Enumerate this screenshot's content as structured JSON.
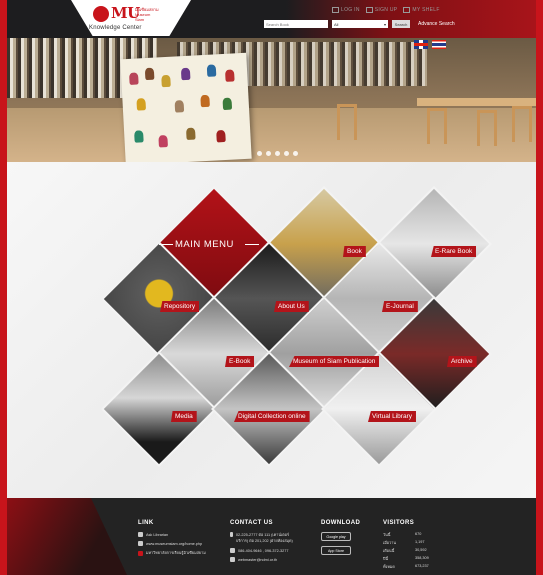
{
  "header": {
    "logo_text": "MU",
    "logo_subtitle": "มิวเซียมสยาม Museum Siam",
    "logo_caption": "Knowledge Center",
    "links": [
      {
        "label": "LOG IN",
        "icon": "login-icon"
      },
      {
        "label": "SIGN UP",
        "icon": "signup-icon"
      },
      {
        "label": "MY SHELF",
        "icon": "shelf-icon"
      }
    ],
    "search": {
      "placeholder": "Search Book",
      "scope": "All",
      "button": "Search",
      "advanced": "Advance Search"
    },
    "languages": [
      "English",
      "Thai"
    ]
  },
  "hero": {
    "slides": 5,
    "active_slide": 1
  },
  "menu": {
    "title": "MAIN MENU",
    "tiles": [
      {
        "label": "Book"
      },
      {
        "label": "E-Rare Book"
      },
      {
        "label": "Repository"
      },
      {
        "label": "About Us"
      },
      {
        "label": "E-Journal"
      },
      {
        "label": "E-Book"
      },
      {
        "label": "Museum of Siam Publication"
      },
      {
        "label": "Archive"
      },
      {
        "label": "Media"
      },
      {
        "label": "Digital Collection online"
      },
      {
        "label": "Virtual Library"
      }
    ]
  },
  "footer": {
    "link": {
      "heading": "LINK",
      "items": [
        {
          "label": "Ask Librarian",
          "icon": "chat-icon"
        },
        {
          "label": "www.museumsiam.org/home.php",
          "icon": "globe-icon"
        },
        {
          "label": "มหาวิทยาลัยการเรียนรู้มิวเซียมสยาม",
          "icon": "info-icon"
        }
      ]
    },
    "contact": {
      "heading": "CONTACT US",
      "items": [
        {
          "label": "02-225-2777 ต่อ 111 (เคาน์เตอร์บริการ) ต่อ 201,202 (ฝ่ายห้องสมุด)",
          "icon": "phone-icon"
        },
        {
          "label": "086-404-9646 , 096-372-3277",
          "icon": "mobile-icon"
        },
        {
          "label": "webmaster@ndmi.or.th",
          "icon": "mail-icon"
        }
      ]
    },
    "download": {
      "heading": "DOWNLOAD",
      "badges": [
        "Google play",
        "App Store"
      ]
    },
    "visitors": {
      "heading": "VISITORS",
      "rows": [
        {
          "label": "วันนี้",
          "value": "670"
        },
        {
          "label": "เมื่อวาน",
          "value": "1,197"
        },
        {
          "label": "เดือนนี้",
          "value": "30,592"
        },
        {
          "label": "ปีนี้",
          "value": "358,309"
        },
        {
          "label": "ทั้งหมด",
          "value": "673,237"
        }
      ]
    }
  },
  "colors": {
    "brand_red": "#c8141b",
    "dark": "#1d1d1f",
    "tile_label": "#b3141a"
  }
}
